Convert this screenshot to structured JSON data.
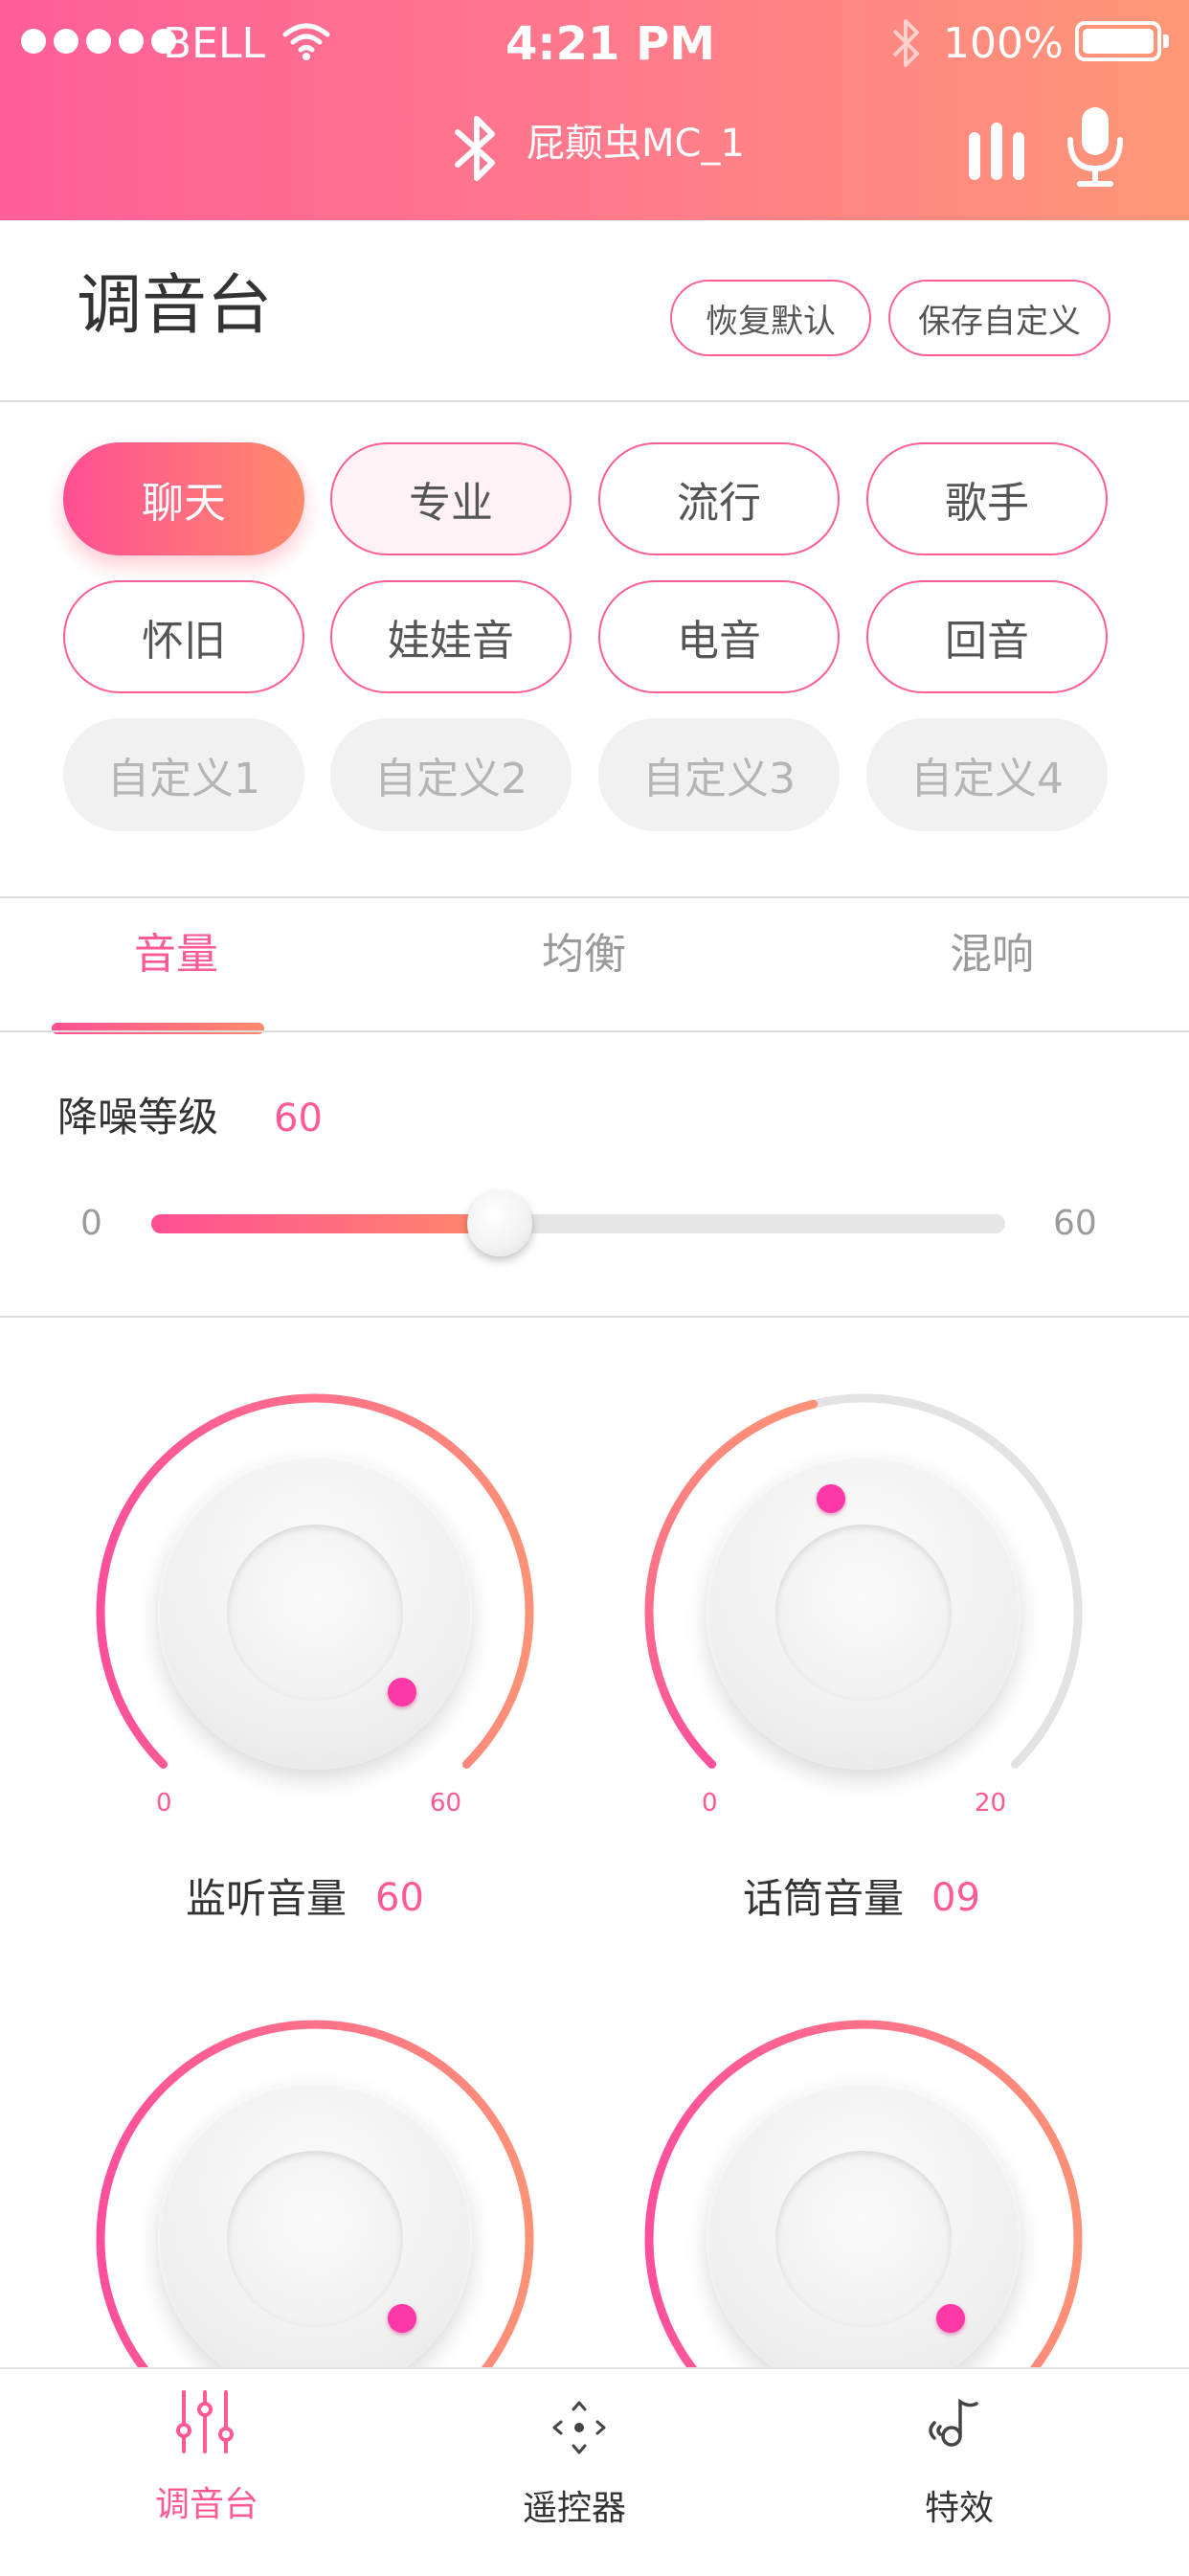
{
  "status_bar": {
    "carrier": "BELL",
    "time": "4:21 PM",
    "battery": "100%"
  },
  "header": {
    "device_name": "屁颠虫MC_1"
  },
  "page": {
    "title": "调音台",
    "restore_default_label": "恢复默认",
    "save_custom_label": "保存自定义"
  },
  "presets": [
    {
      "label": "聊天",
      "state": "selected"
    },
    {
      "label": "专业",
      "state": "normal"
    },
    {
      "label": "流行",
      "state": "normal"
    },
    {
      "label": "歌手",
      "state": "normal"
    },
    {
      "label": "怀旧",
      "state": "normal"
    },
    {
      "label": "娃娃音",
      "state": "normal"
    },
    {
      "label": "电音",
      "state": "normal"
    },
    {
      "label": "回音",
      "state": "normal"
    },
    {
      "label": "自定义1",
      "state": "disabled"
    },
    {
      "label": "自定义2",
      "state": "disabled"
    },
    {
      "label": "自定义3",
      "state": "disabled"
    },
    {
      "label": "自定义4",
      "state": "disabled"
    }
  ],
  "tabs": [
    {
      "label": "音量",
      "active": true
    },
    {
      "label": "均衡",
      "active": false
    },
    {
      "label": "混响",
      "active": false
    }
  ],
  "noise_reduction": {
    "label": "降噪等级",
    "value": "60",
    "min": "0",
    "max": "60",
    "fill_fraction": 0.41
  },
  "knobs": [
    {
      "label": "监听音量",
      "value": "60",
      "min": "0",
      "max": "60",
      "level_fraction": 1.0
    },
    {
      "label": "话筒音量",
      "value": "09",
      "min": "0",
      "max": "20",
      "level_fraction": 0.45
    },
    {
      "label": "",
      "value": "",
      "min": "",
      "max": "",
      "level_fraction": 1.0
    },
    {
      "label": "",
      "value": "",
      "min": "",
      "max": "",
      "level_fraction": 1.0
    }
  ],
  "bottom_nav": [
    {
      "label": "调音台",
      "icon": "sliders-icon",
      "active": true
    },
    {
      "label": "遥控器",
      "icon": "remote-dpad-icon",
      "active": false
    },
    {
      "label": "特效",
      "icon": "music-effect-icon",
      "active": false
    }
  ],
  "colors": {
    "accent": "#ff5a95",
    "gradient_start": "#ff4f94",
    "gradient_end": "#ff8a6a"
  }
}
